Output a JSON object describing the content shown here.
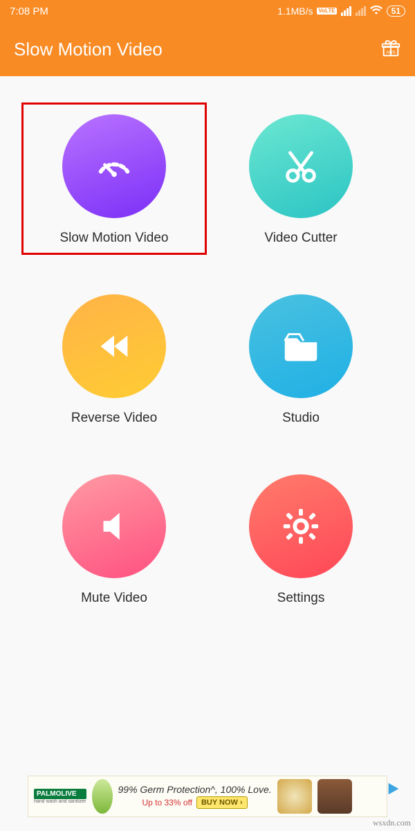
{
  "status": {
    "time": "7:08 PM",
    "net_speed": "1.1MB/s",
    "volte": "VoLTE",
    "battery": "51"
  },
  "header": {
    "title": "Slow Motion Video"
  },
  "tiles": [
    {
      "label": "Slow Motion Video",
      "highlighted": true
    },
    {
      "label": "Video Cutter"
    },
    {
      "label": "Reverse Video"
    },
    {
      "label": "Studio"
    },
    {
      "label": "Mute Video"
    },
    {
      "label": "Settings"
    }
  ],
  "ad": {
    "brand": "PALMOLIVE",
    "tagline": "hand wash and sanitizer",
    "headline": "99% Germ Protection^, 100% Love.",
    "offer": "Up to 33% off",
    "cta": "BUY NOW ›"
  },
  "watermark": "wsxdn.com"
}
